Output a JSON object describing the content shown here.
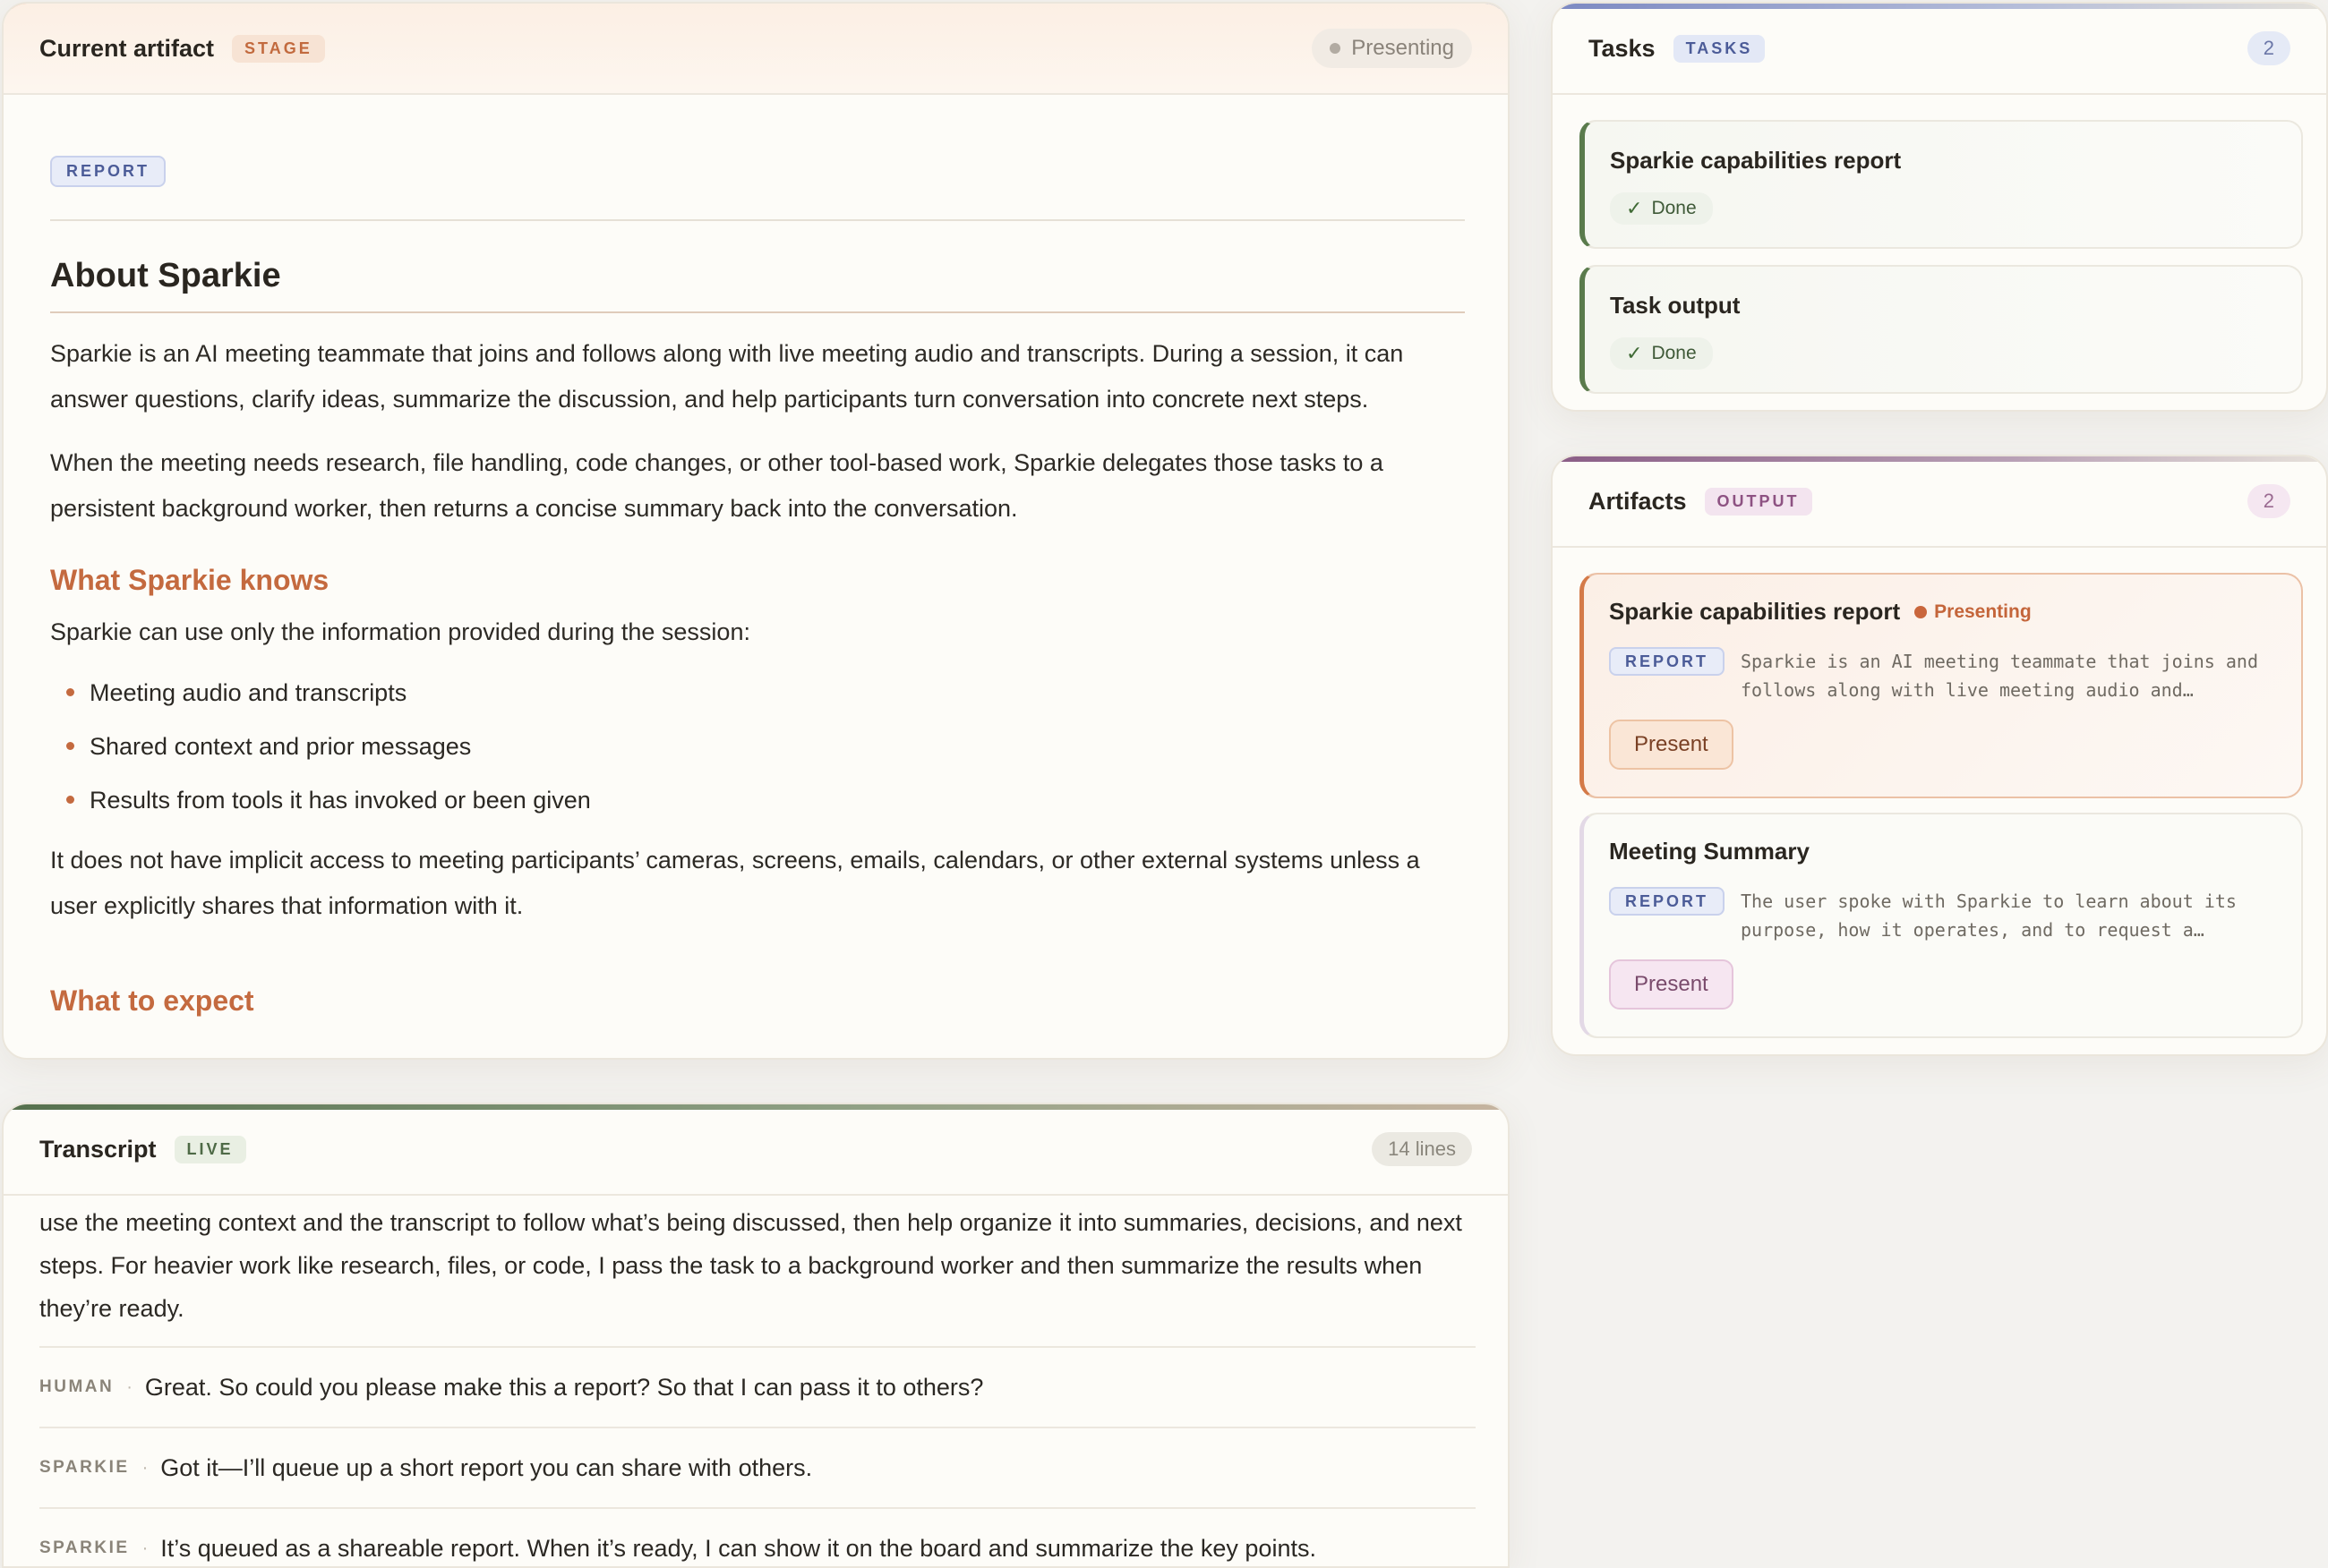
{
  "stage": {
    "title": "Current artifact",
    "chip": "STAGE",
    "status": "Presenting",
    "doc": {
      "tag": "REPORT",
      "heading": "About Sparkie",
      "para1": "Sparkie is an AI meeting teammate that joins and follows along with live meeting audio and transcripts. During a session, it can answer questions, clarify ideas, summarize the discussion, and help participants turn conversation into concrete next steps.",
      "para2": "When the meeting needs research, file handling, code changes, or other tool-based work, Sparkie delegates those tasks to a persistent background worker, then returns a concise summary back into the conversation.",
      "section1": "What Sparkie knows",
      "para3": "Sparkie can use only the information provided during the session:",
      "bullets": [
        "Meeting audio and transcripts",
        "Shared context and prior messages",
        "Results from tools it has invoked or been given"
      ],
      "para4": "It does not have implicit access to meeting participants’ cameras, screens, emails, calendars, or other external systems unless a user explicitly shares that information with it.",
      "section2": "What to expect"
    }
  },
  "transcript": {
    "title": "Transcript",
    "chip": "LIVE",
    "count": "14 lines",
    "lead": "use the meeting context and the transcript to follow what’s being discussed, then help organize it into summaries, decisions, and next steps. For heavier work like research, files, or code, I pass the task to a background worker and then summarize the results when they’re ready.",
    "rows": [
      {
        "speaker": "HUMAN",
        "sep": "·",
        "text": "Great. So could you please make this a report? So that I can pass it to others?"
      },
      {
        "speaker": "SPARKIE",
        "sep": "·",
        "text": "Got it—I’ll queue up a short report you can share with others."
      },
      {
        "speaker": "SPARKIE",
        "sep": "·",
        "text": "It’s queued as a shareable report. When it’s ready, I can show it on the board and summarize the key points."
      }
    ]
  },
  "tasks": {
    "title": "Tasks",
    "chip": "TASKS",
    "count": "2",
    "items": [
      {
        "title": "Sparkie capabilities report",
        "status": "Done"
      },
      {
        "title": "Task output",
        "status": "Done"
      }
    ]
  },
  "artifacts": {
    "title": "Artifacts",
    "chip": "OUTPUT",
    "count": "2",
    "items": [
      {
        "title": "Sparkie capabilities report",
        "status": "Presenting",
        "tag": "REPORT",
        "preview": "Sparkie is an AI meeting teammate that joins and follows along with live meeting audio and transcripts. During a session, it can answer questions",
        "button": "Present"
      },
      {
        "title": "Meeting Summary",
        "tag": "REPORT",
        "preview": "The user spoke with Sparkie to learn about its purpose, how it operates, and to request a shareable report for others",
        "button": "Present"
      }
    ]
  },
  "icons": {
    "check": "✓"
  }
}
